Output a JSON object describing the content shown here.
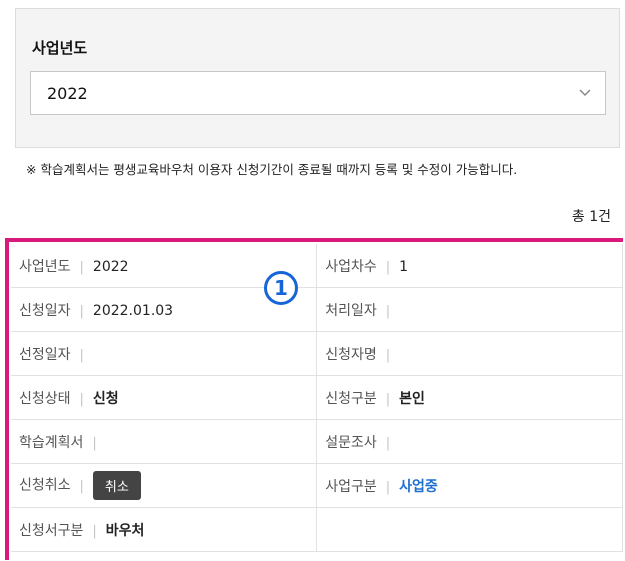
{
  "filter": {
    "label": "사업년도",
    "selected_year": "2022",
    "chevron": "chevron-down-icon"
  },
  "notice": "※ 학습계획서는 평생교육바우처 이용자 신청기간이 종료될 때까지 등록 및 수정이 가능합니다.",
  "total": "총 1건",
  "marker": "1",
  "record": {
    "business_year": {
      "label": "사업년도",
      "value": "2022"
    },
    "business_round": {
      "label": "사업차수",
      "value": "1"
    },
    "apply_date": {
      "label": "신청일자",
      "value": "2022.01.03"
    },
    "process_date": {
      "label": "처리일자",
      "value": ""
    },
    "select_date": {
      "label": "선정일자",
      "value": ""
    },
    "applicant": {
      "label": "신청자명",
      "value": ""
    },
    "apply_status": {
      "label": "신청상태",
      "value": "신청"
    },
    "apply_type": {
      "label": "신청구분",
      "value": "본인"
    },
    "study_plan": {
      "label": "학습계획서",
      "value": ""
    },
    "survey": {
      "label": "설문조사",
      "value": ""
    },
    "apply_cancel": {
      "label": "신청취소",
      "button_label": "취소"
    },
    "business_type": {
      "label": "사업구분",
      "value": "사업중"
    },
    "form_type": {
      "label": "신청서구분",
      "value": "바우처"
    }
  },
  "colors": {
    "accent_border": "#d81b7b",
    "link_blue": "#1e6fd0",
    "marker_blue": "#1565d8",
    "button_dark": "#444444"
  }
}
